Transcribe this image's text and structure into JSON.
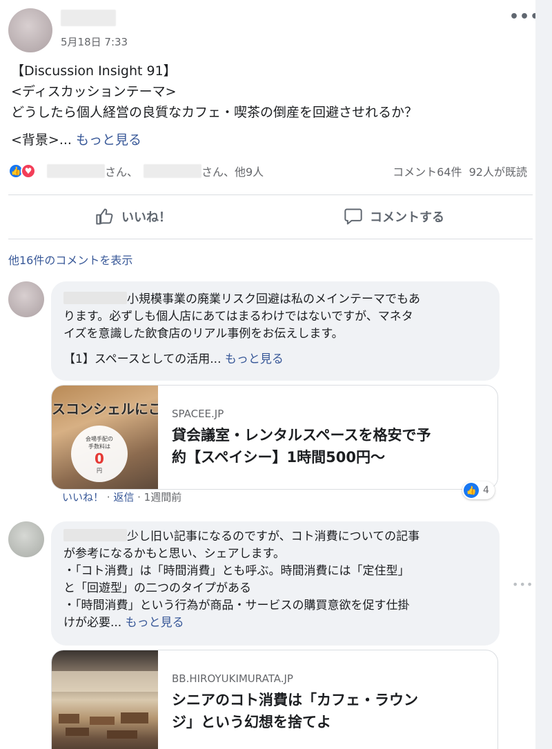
{
  "post": {
    "timestamp": "5月18日 7:33",
    "more_options_icon": "ellipsis-icon",
    "lines": [
      "【Discussion Insight 91】",
      "<ディスカッションテーマ>",
      "どうしたら個人経営の良質なカフェ・喫茶の倒産を回避させれるか？"
    ],
    "background_label": "<背景>",
    "ellipsis": "... ",
    "see_more": "もっと見る"
  },
  "reactions": {
    "icons": [
      "like-icon",
      "love-icon"
    ],
    "san1": "さん、",
    "san2_others": "さん、他9人",
    "comments_count": "コメント64件",
    "seen_by": "92人が既読"
  },
  "actions": {
    "like_label": "いいね！",
    "comment_label": "コメントする"
  },
  "more_comments": "他16件のコメントを表示",
  "comments": [
    {
      "lines": [
        "小規模事業の廃業リスク回避は私のメインテーマでもあ",
        "ります。必ずしも個人店にあてはまるわけではないですが、マネタ",
        "イズを意識した飲食店のリアル事例をお伝えします。"
      ],
      "extra_line": "【1】スペースとしての活用",
      "ellipsis": "... ",
      "see_more": "もっと見る",
      "preview": {
        "image_text": "スコンシェルにこ",
        "badge_line1": "会場手配の",
        "badge_line2": "手数料は",
        "badge_zero": "0",
        "badge_unit": "円",
        "domain": "SPACEE.JP",
        "title_lines": [
          "貸会議室・レンタルスペースを格安で予",
          "約【スペイシー】1時間500円〜"
        ]
      },
      "meta": {
        "like": "いいね！",
        "sep1": " · ",
        "reply": "返信",
        "sep2": " · ",
        "time": "1週間前"
      },
      "like_count": "4"
    },
    {
      "lines": [
        "少し旧い記事になるのですが、コト消費についての記事",
        "が参考になるかもと思い、シェアします。",
        "・「コト消費」は「時間消費」とも呼ぶ。時間消費には「定住型」",
        "と「回遊型」の二つのタイプがある",
        "・「時間消費」という行為が商品・サービスの購買意欲を促す仕掛"
      ],
      "last_line": "けが必要",
      "ellipsis": "... ",
      "see_more": "もっと見る",
      "more_icon": "ellipsis-icon",
      "preview": {
        "domain": "BB.HIROYUKIMURATA.JP",
        "title_lines": [
          "シニアのコト消費は「カフェ・ラウン",
          "ジ」という幻想を捨てよ"
        ]
      }
    }
  ]
}
